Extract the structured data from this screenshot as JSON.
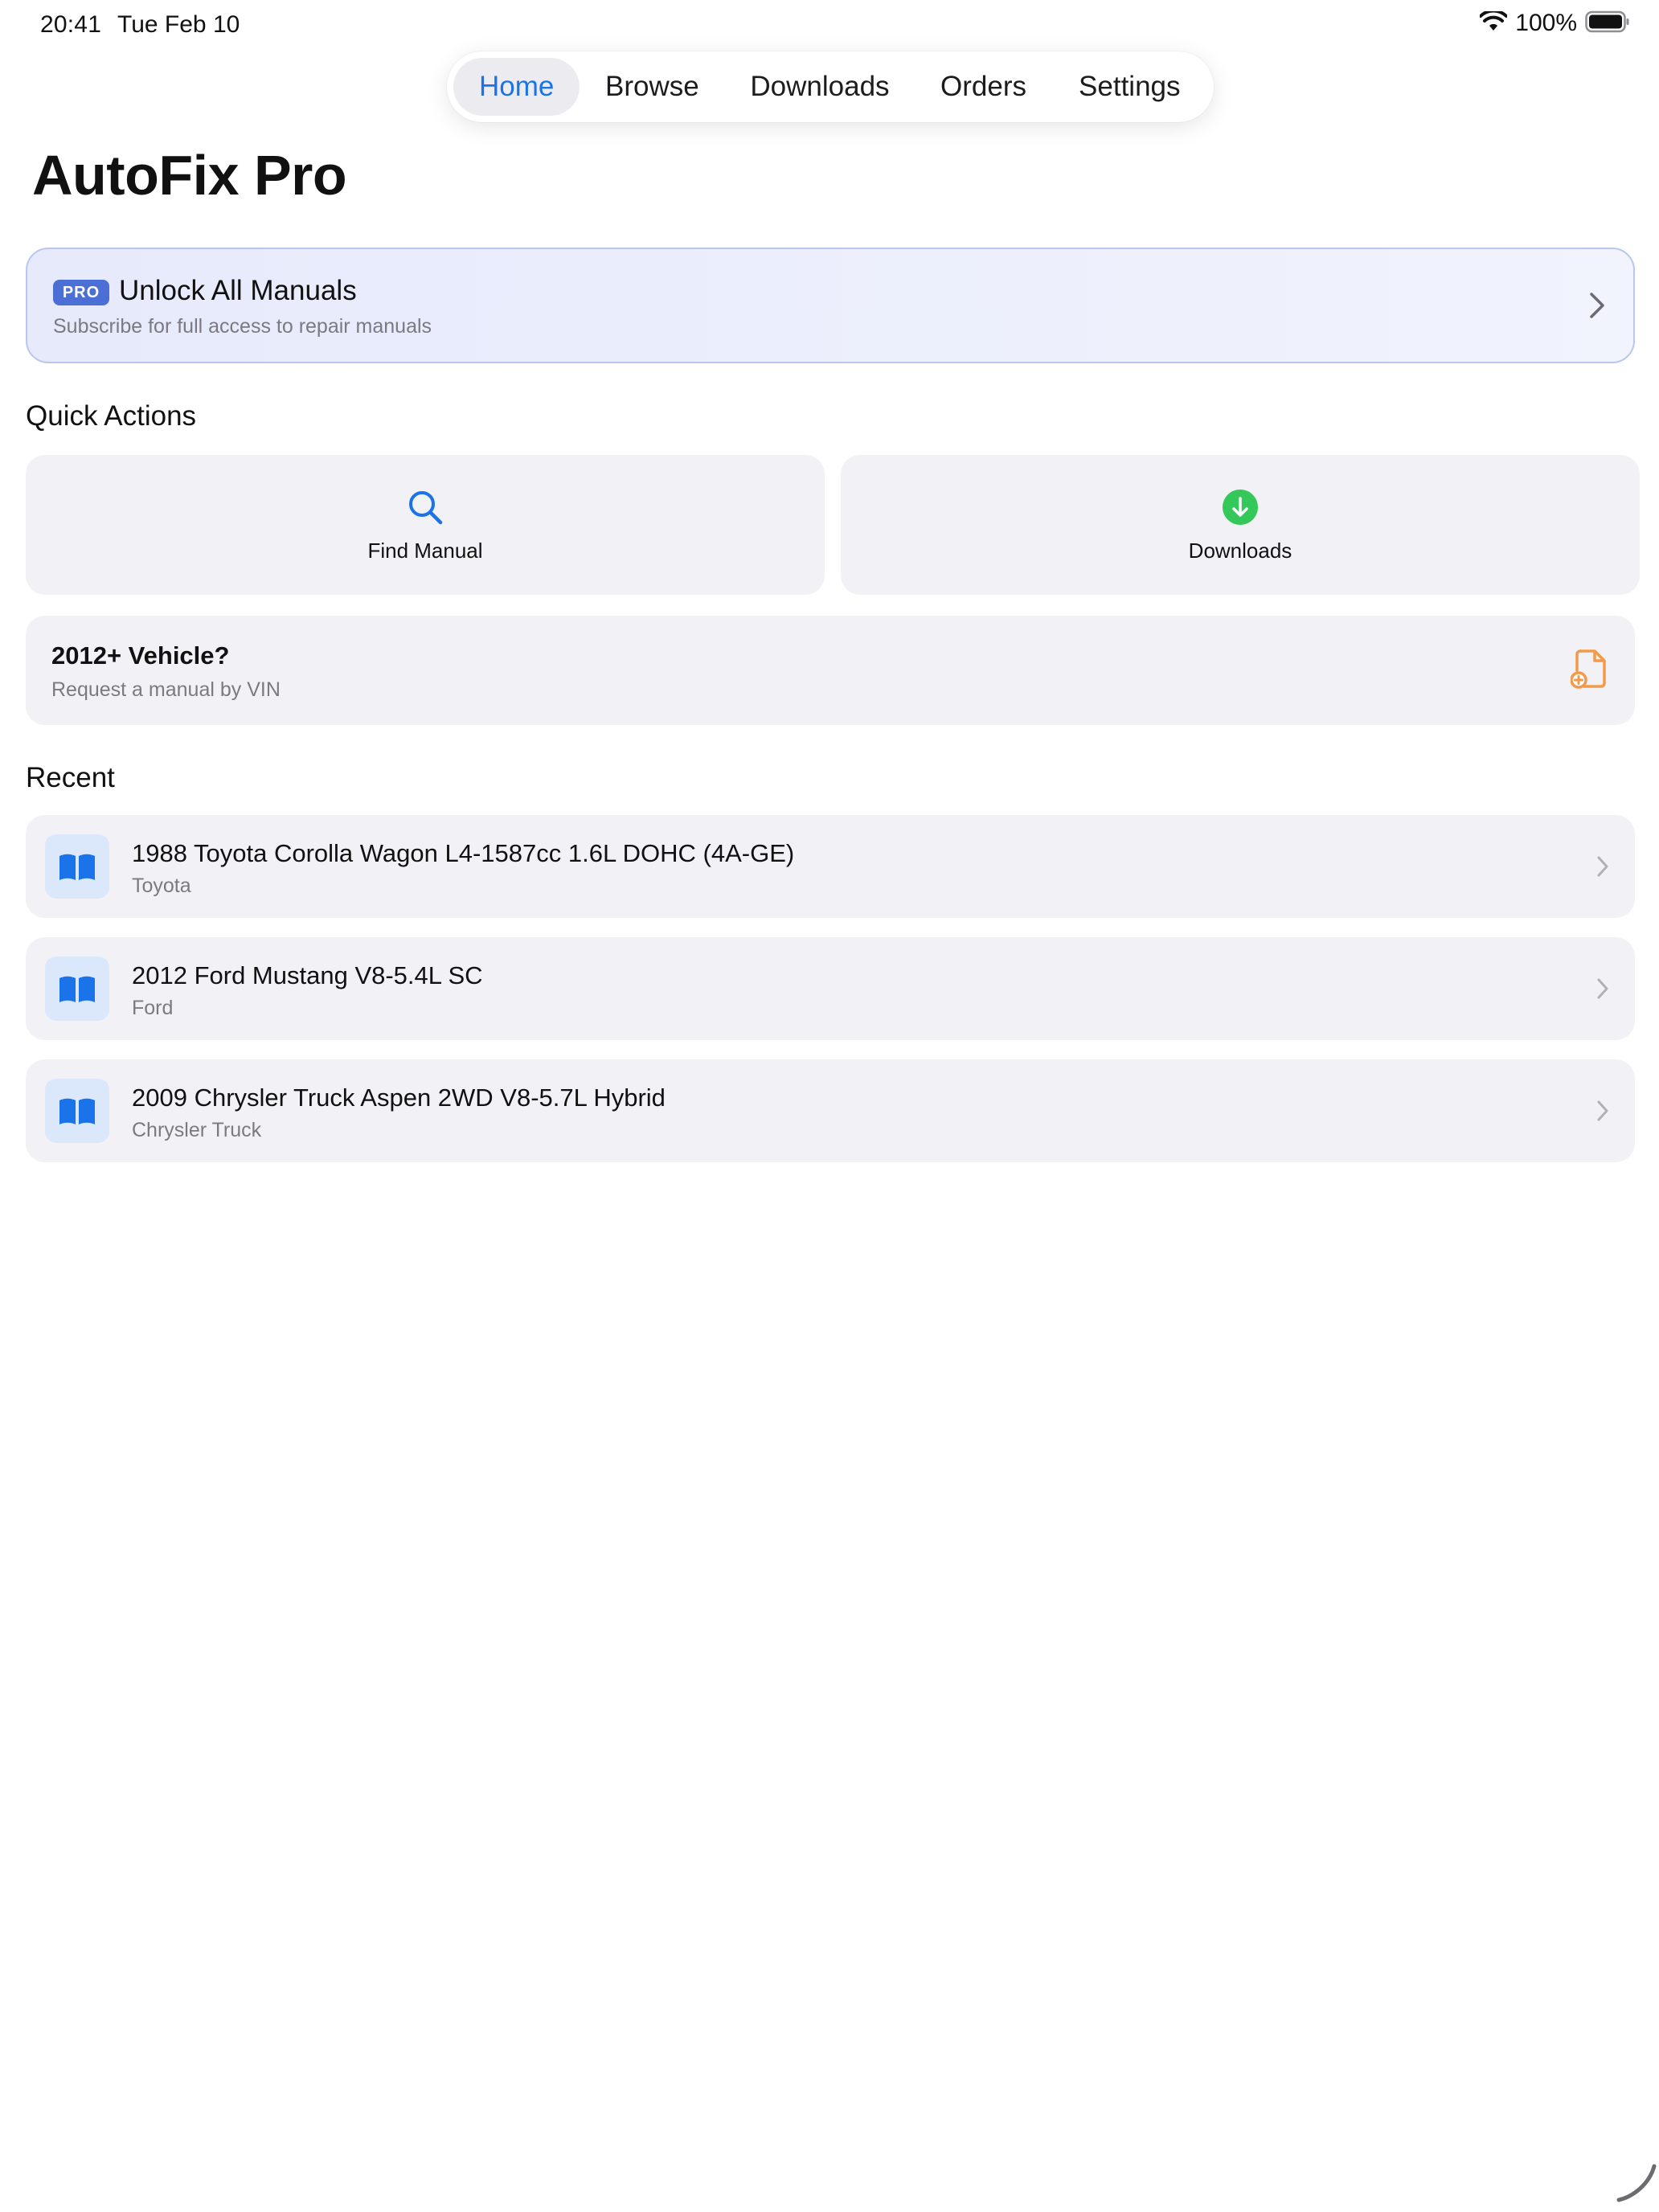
{
  "status_bar": {
    "time": "20:41",
    "date": "Tue Feb 10",
    "battery": "100%"
  },
  "tabs": [
    {
      "label": "Home",
      "active": true
    },
    {
      "label": "Browse",
      "active": false
    },
    {
      "label": "Downloads",
      "active": false
    },
    {
      "label": "Orders",
      "active": false
    },
    {
      "label": "Settings",
      "active": false
    }
  ],
  "page": {
    "title": "AutoFix Pro"
  },
  "pro_banner": {
    "badge": "PRO",
    "title": "Unlock All Manuals",
    "subtitle": "Subscribe for full access to repair manuals"
  },
  "quick_actions": {
    "header": "Quick Actions",
    "find_manual": {
      "label": "Find Manual",
      "icon": "search-icon"
    },
    "downloads": {
      "label": "Downloads",
      "icon": "download-circle-icon"
    }
  },
  "vin_request": {
    "title": "2012+ Vehicle?",
    "subtitle": "Request a manual by VIN",
    "icon": "document-add-icon"
  },
  "recent": {
    "header": "Recent",
    "items": [
      {
        "title": "1988 Toyota Corolla Wagon L4-1587cc 1.6L DOHC (4A-GE)",
        "make": "Toyota"
      },
      {
        "title": "2012 Ford Mustang V8-5.4L SC",
        "make": "Ford"
      },
      {
        "title": "2009 Chrysler Truck Aspen 2WD V8-5.7L Hybrid",
        "make": "Chrysler Truck"
      }
    ]
  },
  "colors": {
    "accent": "#1a73e8",
    "pro_badge": "#4c6fd6",
    "download_green": "#34c759",
    "vin_orange": "#f2994a",
    "card_bg": "#f2f2f6"
  }
}
